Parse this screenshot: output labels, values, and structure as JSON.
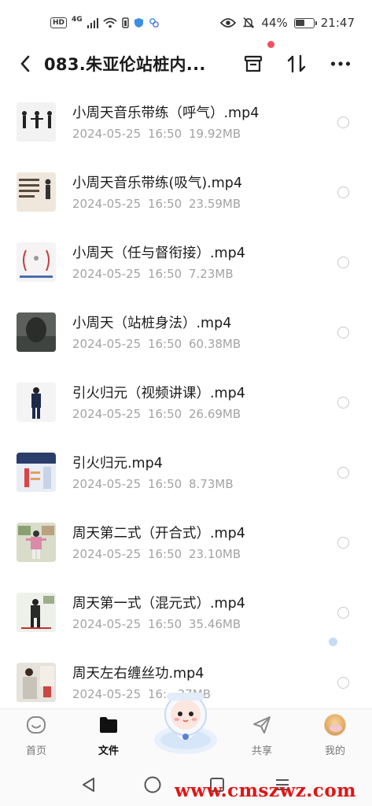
{
  "status_bar": {
    "hd": "HD",
    "network": "4G",
    "battery_text": "44%",
    "time": "21:47"
  },
  "header": {
    "title": "083.朱亚伦站桩内..."
  },
  "files": [
    {
      "name": "小周天音乐带练（呼气）.mp4",
      "date": "2024-05-25",
      "time": "16:50",
      "size": "19.92MB"
    },
    {
      "name": "小周天音乐带练(吸气).mp4",
      "date": "2024-05-25",
      "time": "16:50",
      "size": "23.59MB"
    },
    {
      "name": "小周天（任与督衔接）.mp4",
      "date": "2024-05-25",
      "time": "16:50",
      "size": "7.23MB"
    },
    {
      "name": "小周天（站桩身法）.mp4",
      "date": "2024-05-25",
      "time": "16:50",
      "size": "60.38MB"
    },
    {
      "name": "引火归元（视频讲课）.mp4",
      "date": "2024-05-25",
      "time": "16:50",
      "size": "26.69MB"
    },
    {
      "name": "引火归元.mp4",
      "date": "2024-05-25",
      "time": "16:50",
      "size": "8.73MB"
    },
    {
      "name": "周天第二式（开合式）.mp4",
      "date": "2024-05-25",
      "time": "16:50",
      "size": "23.10MB"
    },
    {
      "name": "周天第一式（混元式）.mp4",
      "date": "2024-05-25",
      "time": "16:50",
      "size": "35.46MB"
    },
    {
      "name": "周天左右缠丝功.mp4",
      "date": "2024-05-25",
      "time": "16:",
      "size": ".37MB"
    }
  ],
  "tabs": [
    {
      "label": "首页",
      "icon": "home-icon"
    },
    {
      "label": "文件",
      "icon": "folder-icon"
    },
    {
      "label": "共享",
      "icon": "send-icon"
    },
    {
      "label": "我的",
      "icon": "avatar"
    }
  ],
  "watermark": "www.cmszwz.com",
  "colors": {
    "accent_red": "#f4505d",
    "watermark": "#e21414",
    "meta_gray": "#a3a3a3"
  }
}
